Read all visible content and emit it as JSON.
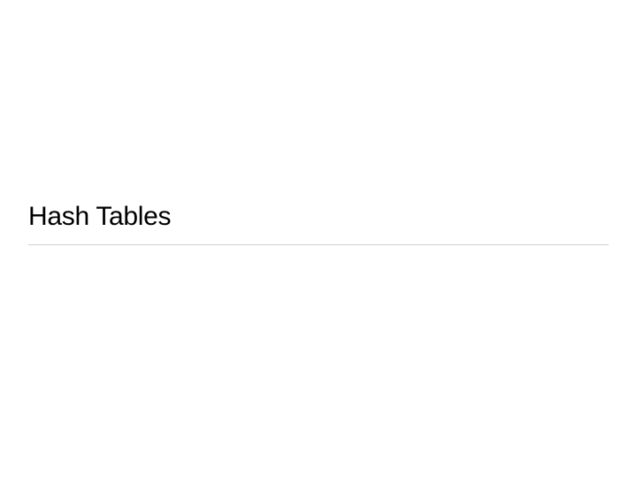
{
  "slide": {
    "title": "Hash Tables"
  }
}
